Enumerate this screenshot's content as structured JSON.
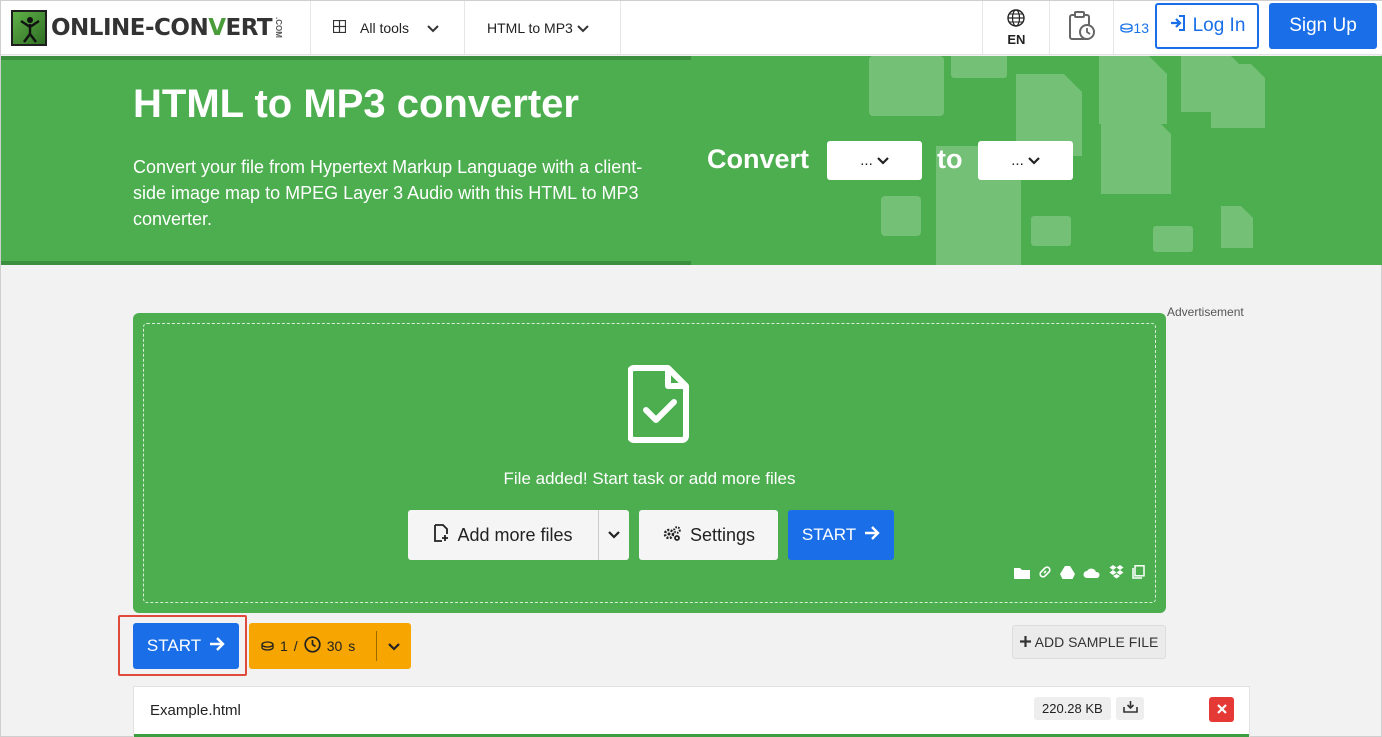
{
  "header": {
    "logo_text_a": "ONLINE-CON",
    "logo_text_b": "V",
    "logo_text_c": "ERT",
    "logo_com": ".COM",
    "all_tools_label": "All tools",
    "converter_label": "HTML to MP3",
    "language": "EN",
    "credits": "13",
    "login_label": "Log In",
    "signup_label": "Sign Up"
  },
  "hero": {
    "title": "HTML to MP3 converter",
    "description": "Convert your file from Hypertext Markup Language with a client-side image map to MPEG Layer 3 Audio with this HTML to MP3 converter.",
    "convert_label": "Convert",
    "to_label": "to",
    "from_select_value": "...",
    "to_select_value": "..."
  },
  "advertisement_label": "Advertisement",
  "dropzone": {
    "status_text": "File added! Start task or add more files",
    "add_more_label": "Add more files",
    "settings_label": "Settings",
    "start_label": "START"
  },
  "actions": {
    "start_label": "START",
    "cost_credits": "1",
    "cost_separator": "/",
    "cost_time": "30",
    "cost_time_unit": "s",
    "add_sample_label": "ADD SAMPLE FILE"
  },
  "file": {
    "name": "Example.html",
    "size": "220.28 KB"
  },
  "colors": {
    "brand_green": "#4cae4f",
    "primary_blue": "#1a6fe8",
    "cost_orange": "#f7a500",
    "delete_red": "#e53935",
    "highlight_outline": "#e04a3a"
  }
}
